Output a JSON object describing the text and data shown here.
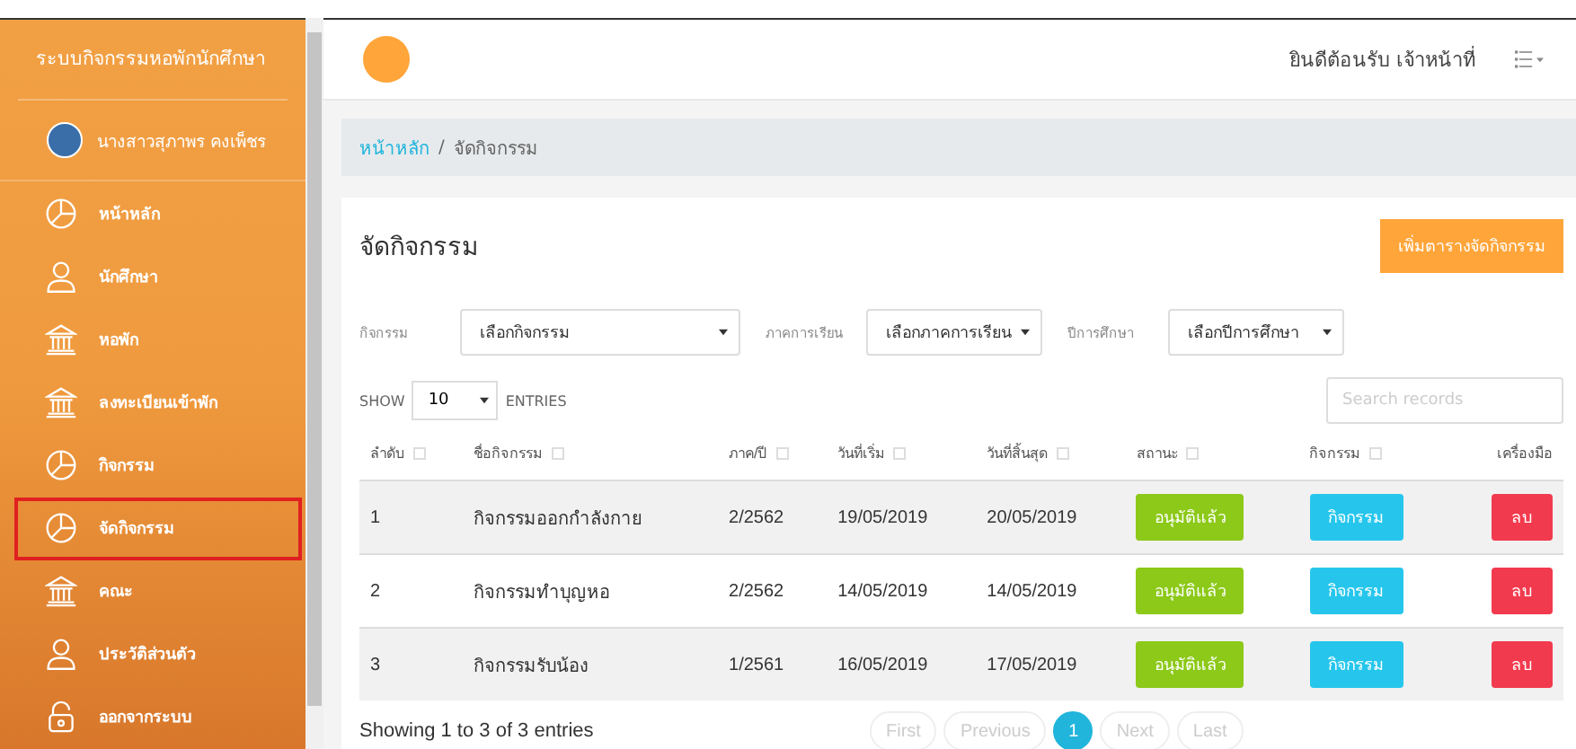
{
  "sidebar": {
    "title": "ระบบกิจกรรมหอพักนักศึกษา",
    "user": "นางสาวสุภาพร คงเพ็ชร",
    "items": [
      {
        "label": "หน้าหลัก",
        "kind": "pie",
        "selected": false
      },
      {
        "label": "นักศึกษา",
        "kind": "person",
        "selected": false
      },
      {
        "label": "หอพัก",
        "kind": "bank",
        "selected": false
      },
      {
        "label": "ลงทะเบียนเข้าพัก",
        "kind": "bank",
        "selected": false
      },
      {
        "label": "กิจกรรม",
        "kind": "pie",
        "selected": false
      },
      {
        "label": "จัดกิจกรรม",
        "kind": "pie",
        "selected": true
      },
      {
        "label": "คณะ",
        "kind": "bank",
        "selected": false
      },
      {
        "label": "ประวัติส่วนตัว",
        "kind": "person",
        "selected": false
      },
      {
        "label": "ออกจากระบบ",
        "kind": "lock",
        "selected": false
      }
    ]
  },
  "topbar": {
    "welcome": "ยินดีต้อนรับ เจ้าหน้าที่"
  },
  "breadcrumb_separator": "/",
  "breadcrumb": [
    {
      "label": "หน้าหลัก",
      "kind": "link"
    },
    {
      "label": "จัดกิจกรรม",
      "kind": "current"
    }
  ],
  "card": {
    "title": "จัดกิจกรรม",
    "add_button": "เพิ่มตารางจัดกิจกรรม",
    "filters": [
      {
        "label": "กิจกรรม",
        "value": "เลือกกิจกรรม"
      },
      {
        "label": "ภาคการเรียน",
        "value": "เลือกภาคการเรียน"
      },
      {
        "label": "ปีการศึกษา",
        "value": "เลือกปีการศึกษา"
      }
    ],
    "show_label": "SHOW",
    "page_size": "10",
    "entries_label": "ENTRIES",
    "search": {
      "placeholder": "Search records"
    },
    "table": {
      "columns": [
        "ลำดับ",
        "ชื่อกิจกรรม",
        "ภาค/ปี",
        "วันที่เริ่ม",
        "วันที่สิ้นสุด",
        "สถานะ",
        "กิจกรรม",
        "เครื่องมือ"
      ],
      "rows": [
        {
          "no": "1",
          "name": "กิจกรรมออกกำลังกาย",
          "term": "2/2562",
          "start": "19/05/2019",
          "end": "20/05/2019",
          "status": "อนุมัติแล้ว",
          "activity": "กิจกรรม",
          "delete": "ลบ"
        },
        {
          "no": "2",
          "name": "กิจกรรมทำบุญหอ",
          "term": "2/2562",
          "start": "14/05/2019",
          "end": "14/05/2019",
          "status": "อนุมัติแล้ว",
          "activity": "กิจกรรม",
          "delete": "ลบ"
        },
        {
          "no": "3",
          "name": "กิจกรรมรับน้อง",
          "term": "1/2561",
          "start": "16/05/2019",
          "end": "17/05/2019",
          "status": "อนุมัติแล้ว",
          "activity": "กิจกรรม",
          "delete": "ลบ"
        }
      ]
    },
    "info": "Showing 1 to 3 of 3 entries",
    "pagination": [
      {
        "label": "First",
        "selected": false,
        "disabled": true
      },
      {
        "label": "Previous",
        "selected": false,
        "disabled": true
      },
      {
        "label": "1",
        "selected": true,
        "disabled": false
      },
      {
        "label": "Next",
        "selected": false,
        "disabled": true
      },
      {
        "label": "Last",
        "selected": false,
        "disabled": true
      }
    ]
  }
}
